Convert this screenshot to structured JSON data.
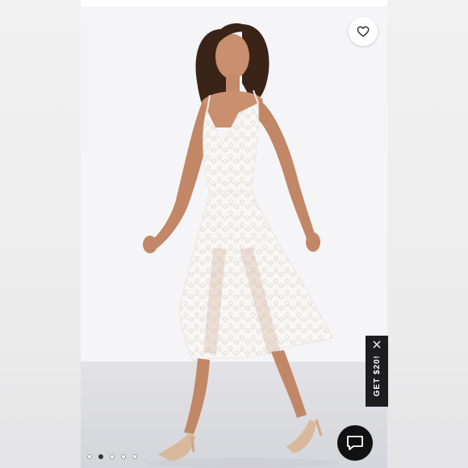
{
  "promo": {
    "label": "GET $20!"
  },
  "icons": {
    "like": "heart-icon",
    "close": "close-icon",
    "chat": "chat-bubble-icon"
  },
  "carousel": {
    "count": 5,
    "active_index": 1
  },
  "colors": {
    "promo_bg": "#1d1d1f",
    "chat_bg": "#111111",
    "background": "#f4f4f6",
    "dress": "#f7f5f2"
  }
}
